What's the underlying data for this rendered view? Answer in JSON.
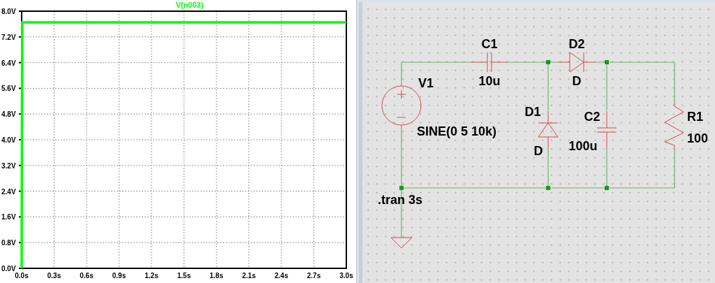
{
  "plot": {
    "chart_data": {
      "type": "line",
      "x": [
        0,
        0.005,
        3
      ],
      "grid": true,
      "series": [
        {
          "name": "V(n003)",
          "color": "#00ff00",
          "values": [
            0,
            7.65,
            7.65
          ]
        }
      ],
      "xlim": [
        0,
        3
      ],
      "ylim": [
        0,
        8
      ],
      "xticks": [
        {
          "value": 0,
          "label": "0.0s"
        },
        {
          "value": 0.3,
          "label": "0.3s"
        },
        {
          "value": 0.6,
          "label": "0.6s"
        },
        {
          "value": 0.9,
          "label": "0.9s"
        },
        {
          "value": 1.2,
          "label": "1.2s"
        },
        {
          "value": 1.5,
          "label": "1.5s"
        },
        {
          "value": 1.8,
          "label": "1.8s"
        },
        {
          "value": 2.1,
          "label": "2.1s"
        },
        {
          "value": 2.4,
          "label": "2.4s"
        },
        {
          "value": 2.7,
          "label": "2.7s"
        },
        {
          "value": 3,
          "label": "3.0s"
        }
      ],
      "yticks": [
        {
          "value": 0,
          "label": "0.0V"
        },
        {
          "value": 0.8,
          "label": "0.8V"
        },
        {
          "value": 1.6,
          "label": "1.6V"
        },
        {
          "value": 2.4,
          "label": "2.4V"
        },
        {
          "value": 3.2,
          "label": "3.2V"
        },
        {
          "value": 4,
          "label": "4.0V"
        },
        {
          "value": 4.8,
          "label": "4.8V"
        },
        {
          "value": 5.6,
          "label": "5.6V"
        },
        {
          "value": 6.4,
          "label": "6.4V"
        },
        {
          "value": 7.2,
          "label": "7.2V"
        },
        {
          "value": 8,
          "label": "8.0V"
        }
      ]
    }
  },
  "schematic": {
    "components": [
      {
        "kind": "source",
        "name": "V1",
        "value": "SINE(0 5 10k)"
      },
      {
        "kind": "capacitor",
        "name": "C1",
        "value": "10u"
      },
      {
        "kind": "diode",
        "name": "D1",
        "value": "D"
      },
      {
        "kind": "diode",
        "name": "D2",
        "value": "D"
      },
      {
        "kind": "capacitor",
        "name": "C2",
        "value": "100u"
      },
      {
        "kind": "resistor",
        "name": "R1",
        "value": "100"
      }
    ],
    "directive": ".tran 3s"
  }
}
